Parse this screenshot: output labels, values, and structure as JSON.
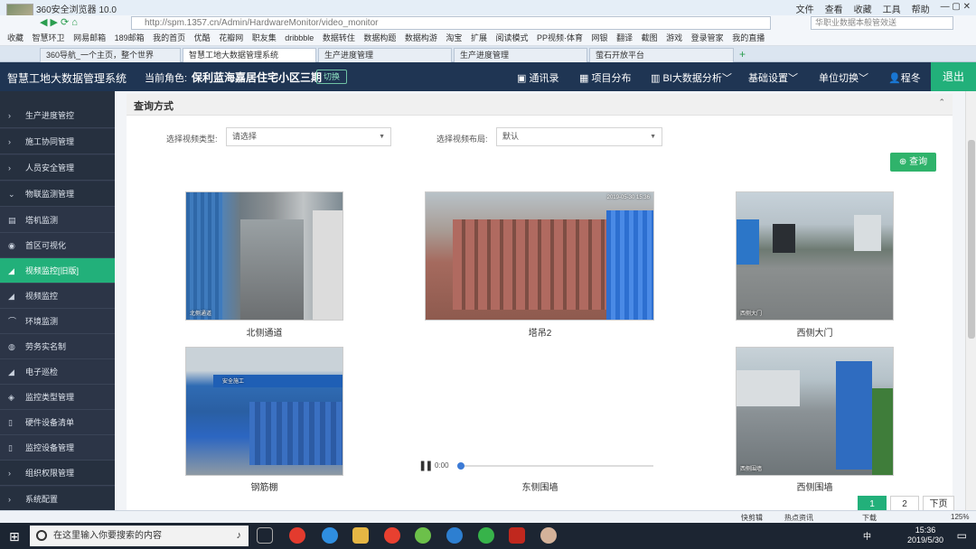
{
  "browser": {
    "title": "360安全浏览器 10.0",
    "menu": [
      "文件",
      "查看",
      "收藏",
      "工具",
      "帮助"
    ],
    "url": "http://spm.1357.cn/Admin/HardwareMonitor/video_monitor",
    "search_placeholder": "华职业数据本般管效送",
    "bookmarks": [
      "收藏",
      "智慧环卫",
      "网易邮箱",
      "189邮箱",
      "我的首页",
      "优酷",
      "花瓣网",
      "职友集",
      "dribbble",
      "数据转住",
      "数据构题",
      "数据构游",
      "淘宝",
      "扩展",
      "阅读模式",
      "PP视频·体育",
      "网银",
      "翻译",
      "截图",
      "游戏",
      "登录管家",
      "我的直播"
    ],
    "tabs": [
      "360导航_一个主页，整个世界",
      "智慧工地大数据管理系统",
      "生产进度管理",
      "生产进度管理",
      "萤石开放平台"
    ],
    "active_tab": "智慧工地大数据管理系统"
  },
  "header": {
    "brand": "智慧工地大数据管理系统",
    "role_label": "当前角色:",
    "project": "保利蓝海嘉居住宅小区三期",
    "switch_label": "切换",
    "nav": [
      "通讯录",
      "项目分布",
      "BI大数据分析",
      "基础设置",
      "单位切换",
      "程冬"
    ],
    "logout": "退出"
  },
  "sidebar": {
    "items": [
      {
        "label": "生产进度管控",
        "icon": "chevron-right-icon",
        "group": true
      },
      {
        "label": "施工协同管理",
        "icon": "chevron-right-icon",
        "group": true
      },
      {
        "label": "人员安全管理",
        "icon": "chevron-right-icon",
        "group": true
      },
      {
        "label": "物联监测管理",
        "icon": "chevron-down-icon",
        "group": true
      },
      {
        "label": "塔机监测",
        "icon": "crane-icon",
        "group": false
      },
      {
        "label": "首区可视化",
        "icon": "visual-icon",
        "group": false
      },
      {
        "label": "视频监控[旧版]",
        "icon": "camera-icon",
        "group": false,
        "active": true
      },
      {
        "label": "视频监控",
        "icon": "camera-icon",
        "group": false
      },
      {
        "label": "环境监测",
        "icon": "env-icon",
        "group": false
      },
      {
        "label": "劳务实名制",
        "icon": "worker-icon",
        "group": false
      },
      {
        "label": "电子巡检",
        "icon": "check-icon",
        "group": false
      },
      {
        "label": "监控类型管理",
        "icon": "type-icon",
        "group": false
      },
      {
        "label": "硬件设备清单",
        "icon": "list-icon",
        "group": false
      },
      {
        "label": "监控设备管理",
        "icon": "device-icon",
        "group": false
      },
      {
        "label": "组织权限管理",
        "icon": "chevron-right-icon",
        "group": true
      },
      {
        "label": "系统配置",
        "icon": "chevron-right-icon",
        "group": true
      }
    ]
  },
  "query": {
    "title": "查询方式",
    "type_label": "选择视频类型:",
    "type_value": "请选择",
    "layout_label": "选择视频布局:",
    "layout_value": "默认",
    "button": "查询"
  },
  "videos": [
    {
      "caption": "北侧通道",
      "overlay": "北侧通道"
    },
    {
      "caption": "塔吊2",
      "overlay": "2019-05-30 15:36"
    },
    {
      "caption": "西侧大门",
      "overlay": "西侧大门"
    },
    {
      "caption": "钢筋棚",
      "overlay": "安全施工"
    },
    {
      "caption": "东侧围墙",
      "overlay": ""
    },
    {
      "caption": "西侧围墙",
      "overlay": "西侧围墙"
    }
  ],
  "player": {
    "time": "0:00",
    "progress": 0
  },
  "pagination": {
    "pages": [
      "1",
      "2"
    ],
    "current": "1",
    "next": "下页"
  },
  "statusbar": {
    "items": [
      "快剪辑",
      "热点资讯",
      "下载",
      "125%"
    ]
  },
  "taskbar": {
    "search_placeholder": "在这里输入你要搜索的内容",
    "time": "15:36",
    "date": "2019/5/30",
    "lang": "中"
  },
  "colors": {
    "accent": "#22b07a",
    "header": "#1f3553",
    "sidebar": "#2c3547"
  }
}
